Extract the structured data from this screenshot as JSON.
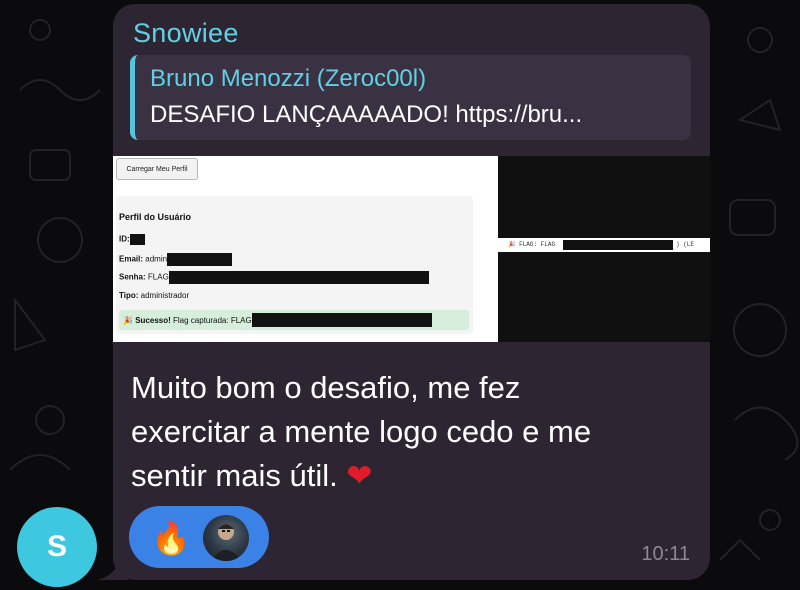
{
  "chat": {
    "sender_name": "Snowiee",
    "avatar_initial": "S",
    "reply": {
      "author": "Bruno Menozzi (Zeroc00l)",
      "text": "DESAFIO LANÇAAAAADO! https://bru..."
    },
    "attachment": {
      "load_button": "Carregar Meu Perfil",
      "profile_title": "Perfil do Usuário",
      "id_label": "ID:",
      "email_label": "Email:",
      "email_value": "admin",
      "senha_label": "Senha:",
      "senha_value": "FLAG",
      "tipo_label": "Tipo:",
      "tipo_value": "administrador",
      "success_icon": "🎉",
      "success_label": "Sucesso!",
      "success_text": "Flag capturada: FLAG",
      "terminal_prefix": "🎉 FLAG: FLAG",
      "terminal_suffix": ") (LE"
    },
    "message_lines": [
      "Muito bom o desafio, me fez",
      "exercitar a mente logo cedo e me",
      "sentir mais útil."
    ],
    "message_emoji": "❤",
    "reaction_emoji": "🔥",
    "timestamp": "10:11"
  },
  "colors": {
    "background": "#0b0a0c",
    "bubble": "#2e2532",
    "accent": "#62d0e4",
    "reaction": "#3b82e6",
    "avatar": "#3ec8e0"
  }
}
